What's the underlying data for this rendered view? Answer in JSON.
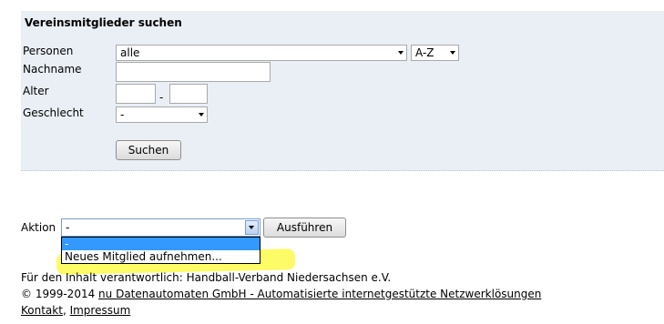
{
  "search_panel": {
    "title": "Vereinsmitglieder suchen",
    "personen_label": "Personen",
    "personen_value": "alle",
    "sort_value": "A-Z",
    "nachname_label": "Nachname",
    "nachname_value": "",
    "alter_label": "Alter",
    "alter_separator": "-",
    "alter_from_value": "",
    "alter_to_value": "",
    "geschlecht_label": "Geschlecht",
    "geschlecht_value": "-",
    "search_button": "Suchen"
  },
  "action_bar": {
    "label": "Aktion",
    "selected_value": "-",
    "execute_button": "Ausführen",
    "options": [
      "-",
      "Neues Mitglied aufnehmen..."
    ],
    "highlight_color": "#fdfb5e",
    "selected_option_color": "#3399ff"
  },
  "footer": {
    "responsible": "Für den Inhalt verantwortlich: Handball-Verband Niedersachsen e.V.",
    "copyright_prefix": "© 1999-2014 ",
    "copyright_link": "nu Datenautomaten GmbH - Automatisierte internetgestützte Netzwerklösungen",
    "contact_link": "Kontakt",
    "separator": ", ",
    "impressum_link": "Impressum"
  }
}
